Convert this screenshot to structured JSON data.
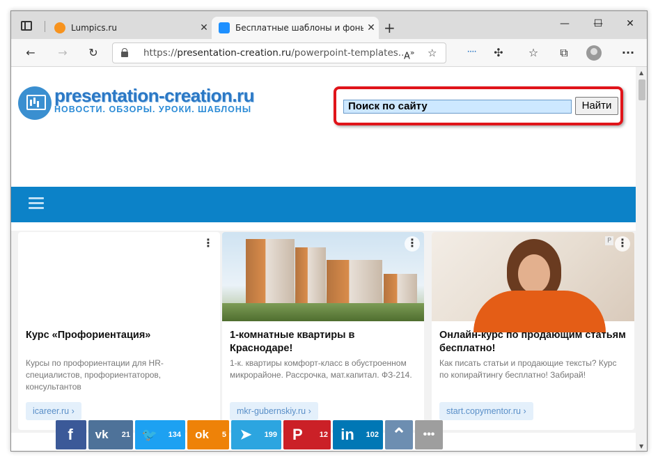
{
  "browser": {
    "tabs": [
      {
        "title": "Lumpics.ru",
        "close": "✕"
      },
      {
        "title": "Бесплатные шаблоны и фоны д",
        "close": "✕"
      }
    ],
    "new_tab": "+",
    "window_controls": {
      "minimize": "—",
      "maximize": "☐",
      "close": "✕"
    },
    "address": {
      "prefix": "https://",
      "host": "presentation-creation.ru",
      "path": "/powerpoint-templates...."
    },
    "toolbar_icons": [
      "back-icon",
      "forward-icon",
      "refresh-icon",
      "read-aloud-icon",
      "favorite-add-icon",
      "extension-icon",
      "puzzle-icon",
      "favorites-icon",
      "collections-icon",
      "profile-icon",
      "more-icon"
    ]
  },
  "site": {
    "title": "presentation-creation.ru",
    "tagline": "НОВОСТИ. ОБЗОРЫ. УРОКИ. ШАБЛОНЫ",
    "search_value": "Поиск по сайту",
    "search_button": "Найти"
  },
  "ads": [
    {
      "title": "Курс «Профориентация»",
      "desc": "Курсы по профориентации для HR-специалистов, профориентаторов, консультантов",
      "source": "icareer.ru ›",
      "menu": "⋮"
    },
    {
      "title": "1-комнатные квартиры в Краснодаре!",
      "desc": "1-к. квартиры комфорт-класс в обустроенном микрорайоне. Рассрочка, мат.капитал. ФЗ-214.",
      "source": "mkr-gubernskiy.ru ›",
      "menu": "⋮"
    },
    {
      "title": "Онлайн-курс по продающим статьям бесплатно!",
      "desc": "Как писать статьи и продающие тексты? Курс по копирайтингу бесплатно! Забирай!",
      "source": "start.copymentor.ru ›",
      "menu": "⋮",
      "badge": "Р"
    }
  ],
  "share": [
    {
      "icon": "f",
      "count": ""
    },
    {
      "icon": "vk",
      "count": "21"
    },
    {
      "icon": "🐦",
      "count": "134"
    },
    {
      "icon": "ok",
      "count": "5"
    },
    {
      "icon": "➤",
      "count": "199"
    },
    {
      "icon": "P",
      "count": "12"
    },
    {
      "icon": "in",
      "count": "102"
    },
    {
      "icon": "⌃",
      "count": ""
    },
    {
      "icon": "•••",
      "count": ""
    }
  ],
  "colors": {
    "nav": "#0c82c8",
    "highlight": "#e0141a",
    "brand": "#2b78c5"
  }
}
